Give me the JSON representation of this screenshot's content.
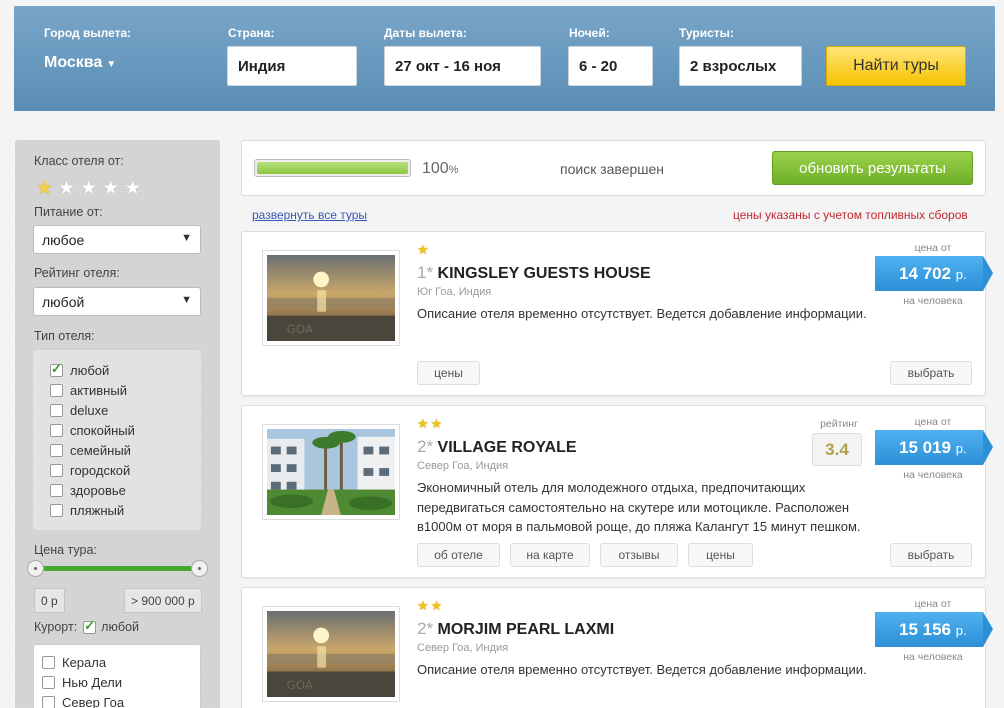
{
  "search": {
    "departure_label": "Город вылета:",
    "departure_city": "Москва",
    "country_label": "Страна:",
    "country": "Индия",
    "dates_label": "Даты вылета:",
    "dates": "27 окт - 16 ноя",
    "nights_label": "Ночей:",
    "nights": "6 - 20",
    "tourists_label": "Туристы:",
    "tourists": "2 взрослых",
    "find_button": "Найти туры"
  },
  "filters": {
    "hotel_class_label": "Класс отеля от:",
    "hotel_class_min_stars": 1,
    "food_label": "Питание от:",
    "food_value": "любое",
    "rating_label": "Рейтинг отеля:",
    "rating_value": "любой",
    "type_label": "Тип отеля:",
    "types": [
      {
        "label": "любой",
        "checked": true
      },
      {
        "label": "активный",
        "checked": false
      },
      {
        "label": "deluxe",
        "checked": false
      },
      {
        "label": "спокойный",
        "checked": false
      },
      {
        "label": "семейный",
        "checked": false
      },
      {
        "label": "городской",
        "checked": false
      },
      {
        "label": "здоровье",
        "checked": false
      },
      {
        "label": "пляжный",
        "checked": false
      }
    ],
    "price_label": "Цена тура:",
    "price_min": "0 р",
    "price_max": "> 900 000 р",
    "resort_label": "Курорт:",
    "resort_any": "любой",
    "resorts": [
      {
        "label": "Керала",
        "checked": false
      },
      {
        "label": "Нью Дели",
        "checked": false
      },
      {
        "label": "Север Гоа",
        "checked": false
      }
    ]
  },
  "status": {
    "progress_percent": 100,
    "percent_number": "100",
    "percent_sign": "%",
    "search_status": "поиск завершен",
    "refresh_button": "обновить результаты",
    "expand_all": "развернуть все туры",
    "fuel_note": "цены указаны с учетом топливных сборов"
  },
  "hotels": [
    {
      "stars": 1,
      "class": "1*",
      "name": "KINGSLEY GUESTS HOUSE",
      "location": "Юг Гоа, Индия",
      "description": "Описание отеля временно отсутствует. Ведется добавление информации.",
      "price_from_label": "цена от",
      "price": "14 702",
      "currency": "р.",
      "per_person": "на человека",
      "buttons": [
        "цены"
      ],
      "choose_button": "выбрать",
      "photo_icon": "beach-sunset-photo"
    },
    {
      "stars": 2,
      "class": "2*",
      "name": "VILLAGE ROYALE",
      "location": "Север Гоа, Индия",
      "description": "Экономичный отель для молодежного отдыха, предпочитающих передвигаться самостоятельно на скутере или мотоцикле. Расположен в1000м от моря в пальмовой роще, до пляжа Калангут 15 минут пешком.",
      "rating_label": "рейтинг",
      "rating": "3.4",
      "price_from_label": "цена от",
      "price": "15 019",
      "currency": "р.",
      "per_person": "на человека",
      "buttons": [
        "об отеле",
        "на карте",
        "отзывы",
        "цены"
      ],
      "choose_button": "выбрать",
      "photo_icon": "hotel-garden-photo"
    },
    {
      "stars": 2,
      "class": "2*",
      "name": "MORJIM PEARL LAXMI",
      "location": "Север Гоа, Индия",
      "description": "Описание отеля временно отсутствует. Ведется добавление информации.",
      "price_from_label": "цена от",
      "price": "15 156",
      "currency": "р.",
      "per_person": "на человека",
      "photo_icon": "beach-sunset-photo"
    }
  ],
  "colors": {
    "header_blue": "#6a9bc0",
    "find_yellow": "#f5c300",
    "refresh_green": "#7cbc33",
    "price_blue": "#3a9de2",
    "fuel_red": "#c0282e",
    "star_gold": "#f2c418"
  }
}
